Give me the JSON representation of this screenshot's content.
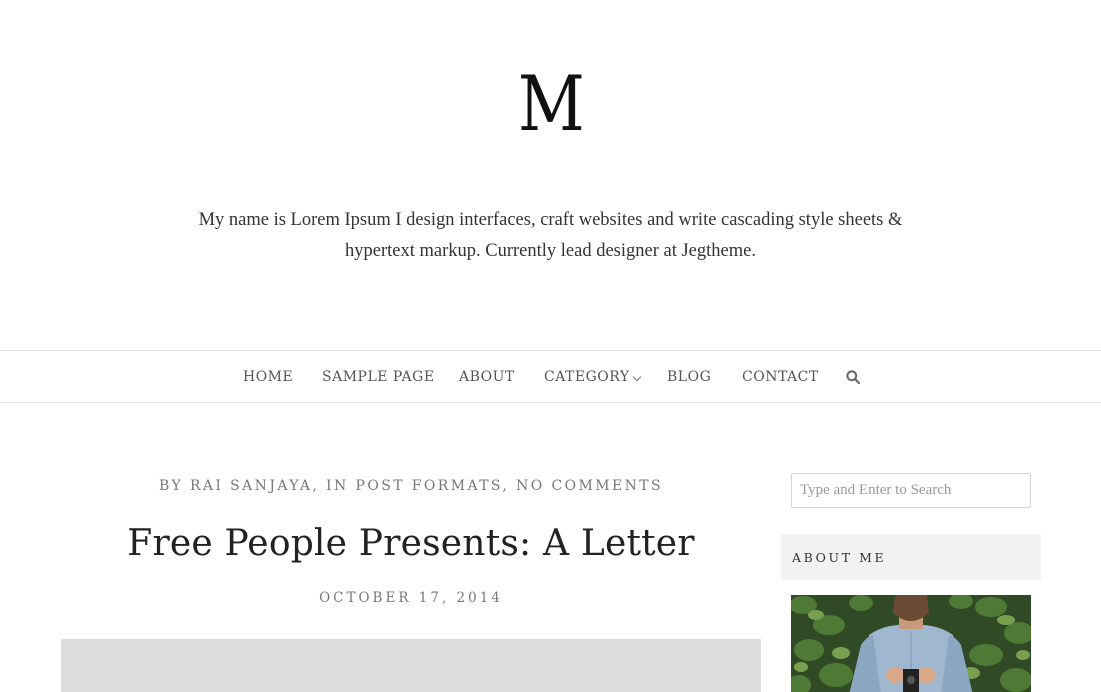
{
  "site": {
    "logo": "M",
    "tagline": "My name is Lorem Ipsum I design interfaces, craft websites and write cascading style sheets & hypertext markup. Currently lead designer at Jegtheme."
  },
  "nav": {
    "items": [
      {
        "label": "HOME"
      },
      {
        "label": "SAMPLE PAGE"
      },
      {
        "label": "ABOUT"
      },
      {
        "label": "CATEGORY",
        "has_submenu": true
      },
      {
        "label": "BLOG"
      },
      {
        "label": "CONTACT"
      }
    ],
    "search_icon": "search-icon"
  },
  "post": {
    "by_prefix": "BY ",
    "author": "RAI SANJAYA",
    "in_prefix": ", IN ",
    "category": "POST FORMATS",
    "comments_sep": ", ",
    "comments": "NO COMMENTS",
    "title": "Free People Presents: A Letter",
    "date": "OCTOBER 17, 2014"
  },
  "sidebar": {
    "search_placeholder": "Type and Enter to Search",
    "about_title": "ABOUT ME"
  },
  "colors": {
    "border": "#e1e1e1",
    "widget_bg": "#f2f2f2",
    "image_placeholder": "#dcdcdc",
    "meta_text": "#777777"
  }
}
